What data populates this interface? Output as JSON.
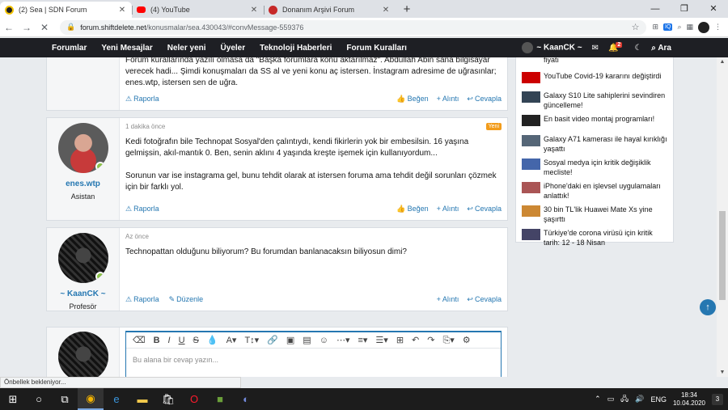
{
  "browser": {
    "tabs": [
      {
        "title": "(2) Sea | SDN Forum",
        "active": true,
        "fav_color": "#1e1f24"
      },
      {
        "title": "(4) YouTube",
        "active": false,
        "fav_color": "#ff0000"
      },
      {
        "title": "Donanım Arşivi Forum",
        "active": false,
        "fav_color": "#c62828"
      }
    ],
    "new_tab": "+",
    "url_host": "forum.shiftdelete.net",
    "url_path": "/konusmalar/sea.430043/#convMessage-559376",
    "status_text": "Önbellek bekleniyor..."
  },
  "forum_nav": {
    "items": [
      "Forumlar",
      "Yeni Mesajlar",
      "Neler yeni",
      "Üyeler",
      "Teknoloji Haberleri",
      "Forum Kuralları"
    ],
    "username": "~ KaanCK ~",
    "alert_count": "2",
    "search": "Ara"
  },
  "posts": [
    {
      "text": "Forum kurallarında yazılı olmasa da \"Başka forumlara konu aktarılmaz\". Abdullah Abin sana bilgisayar verecek hadi... Şimdi konuşmaları da SS al ve yeni konu aç istersen. İnstagram adresime de uğrasınlar; enes.wtp, istersen sen de uğra.",
      "report": "Raporla",
      "like": "Beğen",
      "quote": "+ Alıntı",
      "reply": "Cevapla"
    },
    {
      "date": "1 dakika önce",
      "new_badge": "Yeni",
      "username": "enes.wtp",
      "user_title": "Asistan",
      "text": "Kedi fotoğrafın bile Technopat Sosyal'den çalıntıydı, kendi fikirlerin yok bir embesilsin. 16 yaşına gelmişsin, akıl-mantık 0. Ben, senin aklını 4 yaşında kreşte işemek için kullanıyordum...",
      "text2": "Sorunun var ise instagrama gel, bunu tehdit olarak at istersen foruma ama tehdit değil sorunları çözmek için bir farklı yol.",
      "report": "Raporla",
      "like": "Beğen",
      "quote": "+ Alıntı",
      "reply": "Cevapla"
    },
    {
      "date": "Az önce",
      "username": "~ KaanCK ~",
      "user_title": "Profesör",
      "text": "Technopattan olduğunu biliyorum? Bu forumdan banlanacaksın biliyosun dimi?",
      "report": "Raporla",
      "edit": "Düzenle",
      "quote": "+ Alıntı",
      "reply": "Cevapla"
    }
  ],
  "editor": {
    "placeholder": "Bu alana bir cevap yazın..."
  },
  "sidebar": {
    "news": [
      {
        "title": "fiyatı",
        "thumb": "#888"
      },
      {
        "title": "YouTube Covid-19 kararını değiştirdi",
        "thumb": "#c00"
      },
      {
        "title": "Galaxy S10 Lite sahiplerini sevindiren güncelleme!",
        "thumb": "#345"
      },
      {
        "title": "En basit video montaj programları!",
        "thumb": "#222"
      },
      {
        "title": "Galaxy A71 kamerası ile hayal kırıklığı yaşattı",
        "thumb": "#567"
      },
      {
        "title": "Sosyal medya için kritik değişiklik mecliste!",
        "thumb": "#46a"
      },
      {
        "title": "iPhone'daki en işlevsel uygulamaları anlattık!",
        "thumb": "#a55"
      },
      {
        "title": "30 bin TL'lik Huawei Mate Xs yine şaşırttı",
        "thumb": "#c83"
      },
      {
        "title": "Türkiye'de corona virüsü için kritik tarih: 12 - 18 Nisan",
        "thumb": "#446"
      }
    ]
  },
  "taskbar": {
    "time": "18:34",
    "date": "10.04.2020",
    "notifications": "3"
  }
}
